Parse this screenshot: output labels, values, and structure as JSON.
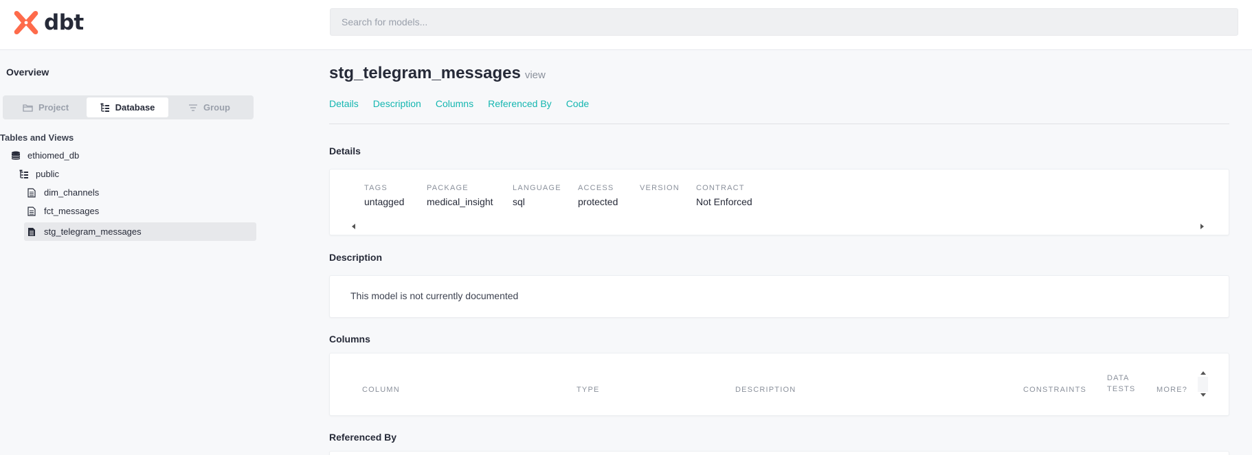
{
  "header": {
    "logo_text": "dbt",
    "logo_color": "#fe6b4b",
    "search_placeholder": "Search for models..."
  },
  "sidebar": {
    "overview_label": "Overview",
    "segments": [
      {
        "label": "Project",
        "icon": "folder-icon",
        "active": false
      },
      {
        "label": "Database",
        "icon": "tree-icon",
        "active": true
      },
      {
        "label": "Group",
        "icon": "filter-lines-icon",
        "active": false
      }
    ],
    "tables_heading": "Tables and Views",
    "tree": {
      "database": "ethiomed_db",
      "schema": "public",
      "models": [
        "dim_channels",
        "fct_messages",
        "stg_telegram_messages"
      ],
      "selected_model": "stg_telegram_messages"
    }
  },
  "main": {
    "title": "stg_telegram_messages",
    "title_sub": "view",
    "tabs": [
      "Details",
      "Description",
      "Columns",
      "Referenced By",
      "Code"
    ],
    "accent_color": "#14b6b0",
    "details": {
      "heading": "Details",
      "fields": [
        {
          "label": "TAGS",
          "value": "untagged"
        },
        {
          "label": "PACKAGE",
          "value": "medical_insight"
        },
        {
          "label": "LANGUAGE",
          "value": "sql"
        },
        {
          "label": "ACCESS",
          "value": "protected"
        },
        {
          "label": "VERSION",
          "value": ""
        },
        {
          "label": "CONTRACT",
          "value": "Not Enforced"
        }
      ]
    },
    "description": {
      "heading": "Description",
      "text": "This model is not currently documented"
    },
    "columns": {
      "heading": "Columns",
      "headers": {
        "column": "COLUMN",
        "type": "TYPE",
        "description": "DESCRIPTION",
        "constraints": "CONSTRAINTS",
        "data_tests_1": "DATA",
        "data_tests_2": "TESTS",
        "more": "MORE?"
      }
    },
    "referenced_by": {
      "heading": "Referenced By"
    }
  }
}
